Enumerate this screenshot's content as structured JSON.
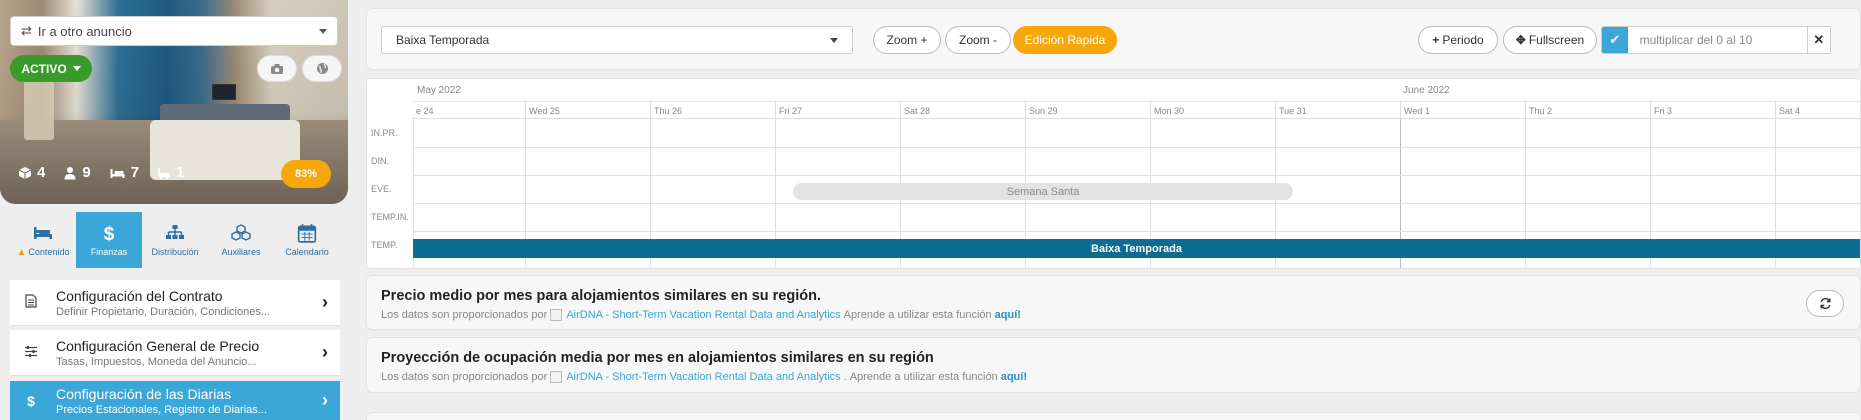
{
  "sidebar": {
    "goto_label": "Ir a otro anuncio",
    "status_label": "ACTIVO",
    "stats": [
      {
        "icon": "cube-icon",
        "value": "4"
      },
      {
        "icon": "person-icon",
        "value": "9"
      },
      {
        "icon": "bed-icon",
        "value": "7"
      },
      {
        "icon": "bath-icon",
        "value": "1"
      }
    ],
    "percent": "83%",
    "tabs": [
      {
        "label": "Contenido",
        "icon": "bed-icon",
        "warning": true
      },
      {
        "label": "Finanzas",
        "icon": "dollar-icon",
        "active": true
      },
      {
        "label": "Distribución",
        "icon": "sitemap-icon"
      },
      {
        "label": "Auxiliares",
        "icon": "cubes-icon"
      },
      {
        "label": "Calendario",
        "icon": "calendar-icon"
      }
    ],
    "menu": [
      {
        "title": "Configuración del Contrato",
        "subtitle": "Definir Propietario, Duración, Condiciones...",
        "icon": "document-icon"
      },
      {
        "title": "Configuración General de Precio",
        "subtitle": "Tasas, Impuestos, Moneda del Anuncio...",
        "icon": "sliders-icon"
      },
      {
        "title": "Configuración de las Diarias",
        "subtitle": "Precios Estacionales, Registro de Diarias...",
        "icon": "dollar-icon",
        "active": true
      }
    ]
  },
  "toolbar": {
    "season_value": "Baixa Temporada",
    "zoom_in": "Zoom +",
    "zoom_out": "Zoom -",
    "quick_edit": "Edición Rapida",
    "period": "Periodo",
    "fullscreen": "Fullscreen",
    "multiply_placeholder": "multiplicar del 0 al 10"
  },
  "calendar": {
    "months": [
      "May 2022",
      "June 2022"
    ],
    "days": [
      "e 24",
      "Wed 25",
      "Thu 26",
      "Fri 27",
      "Sat 28",
      "Sun 29",
      "Mon 30",
      "Tue 31",
      "Wed 1",
      "Thu 2",
      "Fri 3",
      "Sat 4"
    ],
    "row_labels": [
      "IN.PR.",
      "DIN.",
      "EVE.",
      "TEMP.IN.",
      "TEMP."
    ],
    "event_label": "Semana Santa",
    "season_label": "Baixa Temporada"
  },
  "panels": {
    "avg_price_title": "Precio medio por mes para alojamientos similares en su región.",
    "occupancy_title": "Proyección de ocupación media por mes en alojamientos similares en su región",
    "data_from": "Los datos son proporcionados por",
    "airdna_text": "AirDNA - Short-Term Vacation Rental Data and Analytics",
    "learn_text_1": "Aprende a utilizar esta función",
    "learn_text_2": "Aprende a utilizar esta función",
    "here": "aquí!",
    "period_dot": "."
  },
  "colors": {
    "accent_blue": "#3aa7d8",
    "season_blue": "#0e6b92",
    "orange": "#f7a70a",
    "green": "#3a9a2c"
  }
}
